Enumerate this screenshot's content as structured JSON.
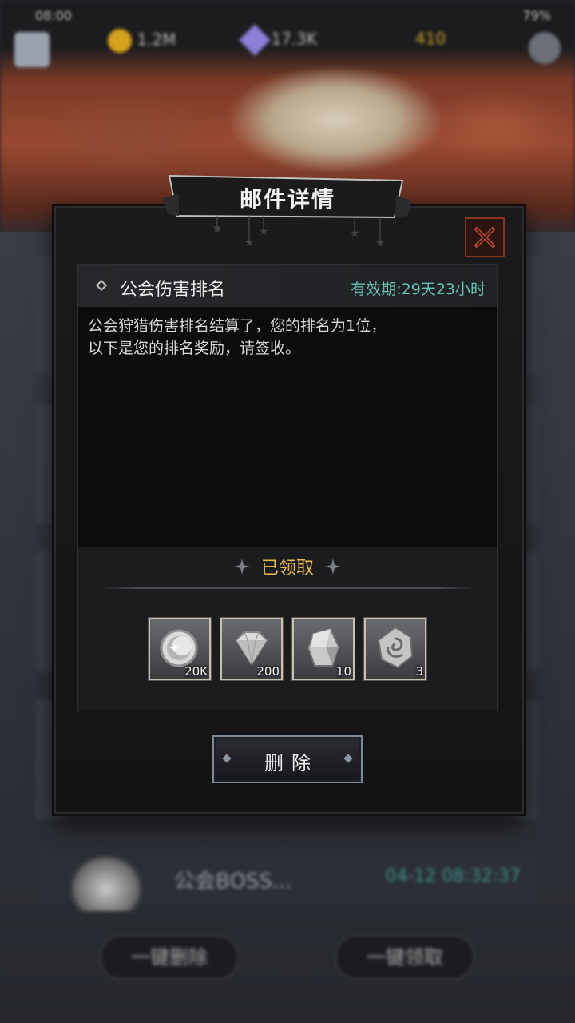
{
  "status_bar": {
    "time": "08:00",
    "battery": "79%"
  },
  "currency": {
    "gold": "1.2M",
    "gems": "17.3K",
    "energy": "410"
  },
  "dialog": {
    "title": "邮件详情",
    "subject": "公会伤害排名",
    "validity": "有效期:29天23小时",
    "body": "公会狩猎伤害排名结算了，您的排名为1位，\n以下是您的排名奖励，请签收。",
    "claimed_label": "已领取",
    "rewards": [
      {
        "icon": "moon-coin-icon",
        "count": "20K"
      },
      {
        "icon": "diamond-icon",
        "count": "200"
      },
      {
        "icon": "ore-stone-icon",
        "count": "10"
      },
      {
        "icon": "rune-stone-icon",
        "count": "3"
      }
    ],
    "delete_label": "删除"
  },
  "background": {
    "row_title": "公会BOSS...",
    "row_date": "04-12  08:32:37",
    "btn_left": "一键删除",
    "btn_right": "一键领取"
  },
  "colors": {
    "accent_gold": "#e8b84a",
    "validity_teal": "#5fc4b7",
    "close_red": "#8a3320"
  }
}
